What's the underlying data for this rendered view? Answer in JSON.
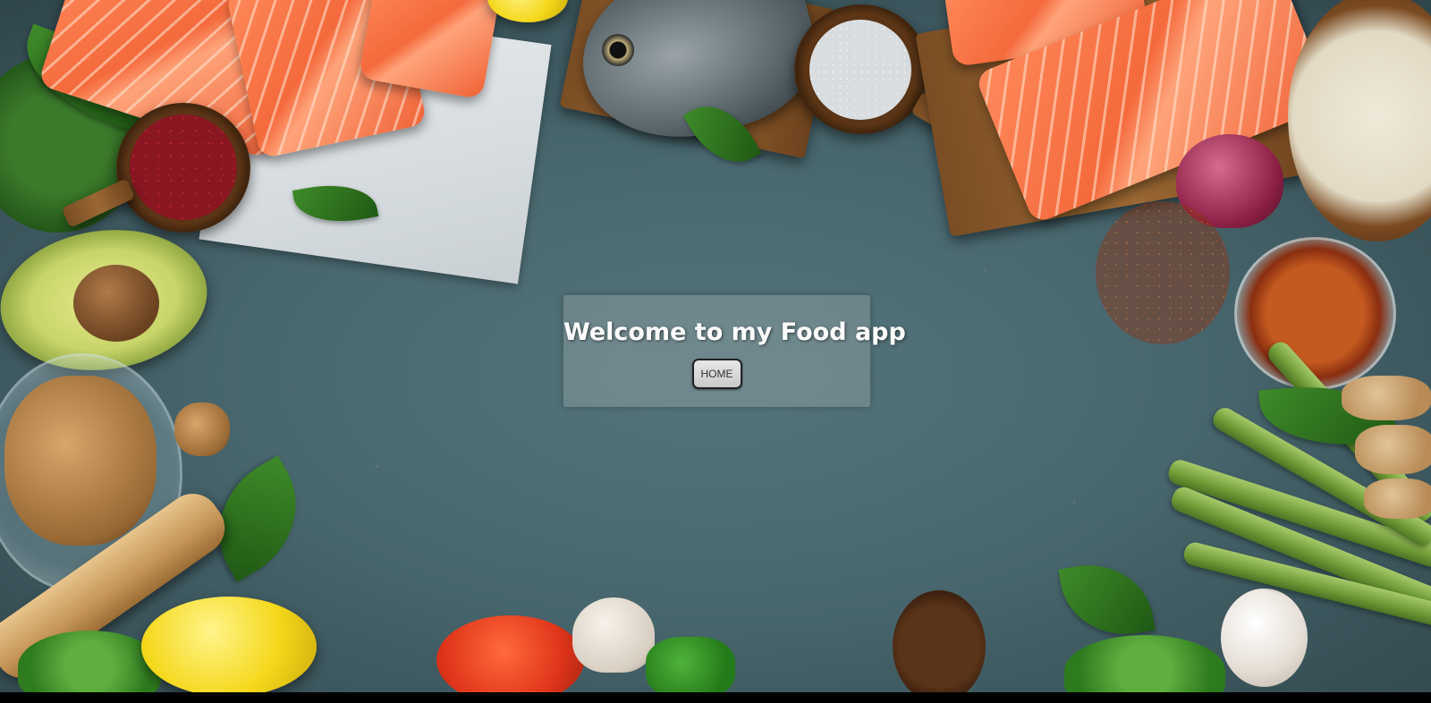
{
  "page": {
    "background_scene": "food-ingredients-on-slate"
  },
  "welcome": {
    "title": "Welcome to my Food app",
    "home_button_label": "HOME"
  },
  "colors": {
    "slate": "#46646b",
    "salmon": "#f46a3c",
    "button_bg": "#d9d9d9",
    "title_text": "#ffffff"
  }
}
